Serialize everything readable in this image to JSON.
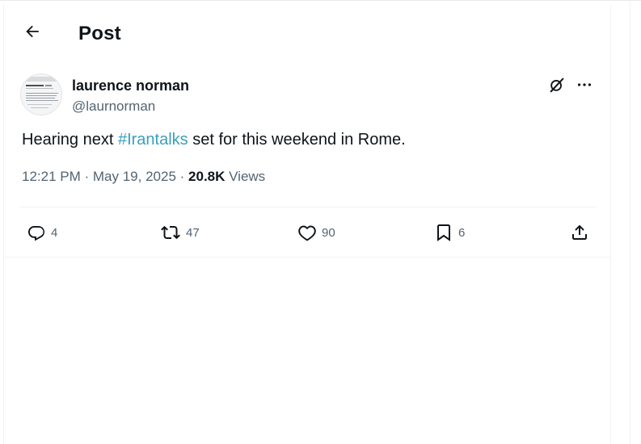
{
  "header": {
    "back_icon": "arrow-left-icon",
    "title": "Post"
  },
  "author": {
    "display_name": "laurence norman",
    "handle": "@laurnorman"
  },
  "tweet": {
    "text_before": "Hearing next ",
    "hashtag": "#Irantalks",
    "text_after": " set for this weekend in Rome.",
    "time": "12:21 PM",
    "date": "May 19, 2025",
    "views_count": "20.8K",
    "views_label": "Views"
  },
  "actions": {
    "replies": "4",
    "reposts": "47",
    "likes": "90",
    "bookmarks": "6"
  },
  "colors": {
    "text": "#0f1419",
    "secondary": "#536471",
    "hashtag": "#3a9fbd",
    "border": "#eff3f4"
  }
}
